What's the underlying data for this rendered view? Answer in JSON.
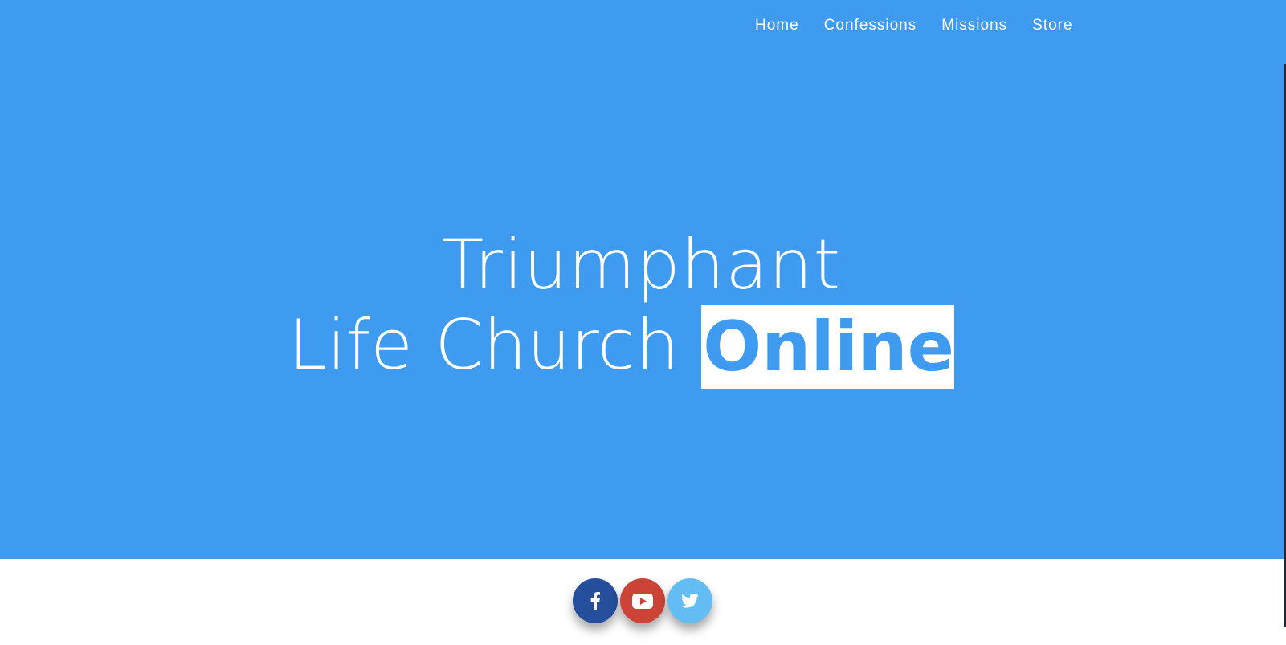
{
  "nav": {
    "items": [
      {
        "label": "Home"
      },
      {
        "label": "Confessions"
      },
      {
        "label": "Missions"
      },
      {
        "label": "Store"
      }
    ]
  },
  "hero": {
    "line1": "Triumphant",
    "line2": "Life Church ",
    "highlight": "Online",
    "background_color": "#3e9bf0"
  },
  "social": [
    {
      "icon": "facebook-icon",
      "color": "#254f9c"
    },
    {
      "icon": "youtube-icon",
      "color": "#cc4438"
    },
    {
      "icon": "twitter-icon",
      "color": "#63bdf2"
    }
  ]
}
